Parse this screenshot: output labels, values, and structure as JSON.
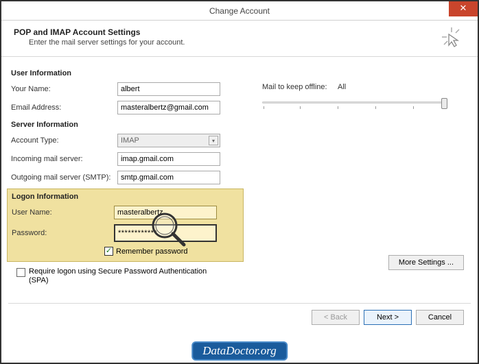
{
  "window": {
    "title": "Change Account",
    "close_char": "✕"
  },
  "header": {
    "title": "POP and IMAP Account Settings",
    "subtitle": "Enter the mail server settings for your account."
  },
  "sections": {
    "user_info": "User Information",
    "server_info": "Server Information",
    "logon_info": "Logon Information"
  },
  "labels": {
    "your_name": "Your Name:",
    "email": "Email Address:",
    "account_type": "Account Type:",
    "incoming": "Incoming mail server:",
    "outgoing": "Outgoing mail server (SMTP):",
    "username": "User Name:",
    "password": "Password:",
    "remember": "Remember password",
    "spa": "Require logon using Secure Password Authentication (SPA)",
    "mail_keep": "Mail to keep offline:",
    "mail_keep_value": "All",
    "more_settings": "More Settings ...",
    "back": "< Back",
    "next": "Next >",
    "cancel": "Cancel"
  },
  "values": {
    "your_name": "albert",
    "email": "masteralbertz@gmail.com",
    "account_type": "IMAP",
    "incoming": "imap.gmail.com",
    "outgoing": "smtp.gmail.com",
    "username": "masteralbertz",
    "password": "************",
    "remember_checked": "✓"
  },
  "watermark": "DataDoctor.org"
}
